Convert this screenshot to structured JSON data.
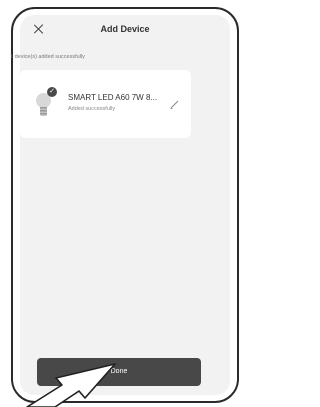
{
  "header": {
    "title": "Add Device",
    "close_icon": "close-icon"
  },
  "status_text": "1 device(s) added successfully",
  "device": {
    "name": "SMART LED A60 7W 8...",
    "status": "Added successfully",
    "icon": "bulb-icon",
    "badge_icon": "check-icon",
    "edit_icon": "edit-pencil-icon"
  },
  "done_button": {
    "label": "Done"
  },
  "colors": {
    "button": "#484848",
    "screen_bg": "#f2f2f2",
    "card_bg": "#ffffff"
  }
}
